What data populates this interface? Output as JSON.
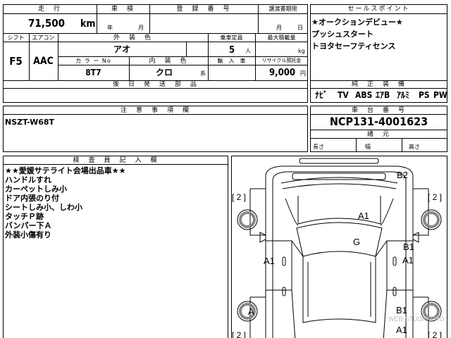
{
  "header": {
    "mileage_label": "走　行",
    "shaken_label": "車　検",
    "reg_label": "登　録　番　号",
    "transfer_deadline_label": "譲渡書期限",
    "sales_point_label": "セールスポイント",
    "mileage_value": "71,500",
    "mileage_unit": "km",
    "shaken_year_unit": "年",
    "shaken_month_unit": "月",
    "transfer_month_unit": "月",
    "transfer_day_unit": "日"
  },
  "sales_points": [
    "★オークションデビュー★",
    "プッシュスタート",
    "トヨタセーフティセンス"
  ],
  "spec": {
    "shift_label": "シフト",
    "aircon_label": "エアコン",
    "ext_color_label": "外　装　色",
    "capacity_label": "乗車定員",
    "max_load_label": "最大積載量",
    "shift_value": "F5",
    "aircon_value": "AAC",
    "ext_color_value": "アオ",
    "capacity_value": "5",
    "capacity_unit": "人",
    "max_load_unit": "kg",
    "color_no_label": "カ ラ ー No",
    "int_color_label": "内　装　色",
    "import_label": "輸　入　車",
    "recycle_label": "リサイクル預託金",
    "color_no_value": "8T7",
    "int_color_value": "クロ",
    "int_color_suffix": "系",
    "recycle_value": "9,000",
    "recycle_unit": "円",
    "retrofit_label": "後　日　発　送　部　品",
    "genuine_label": "純　正　装　備",
    "equipment": [
      "ﾅﾋﾞ",
      "TV",
      "ABS",
      "ｴｱB",
      "ｱﾙﾐ",
      "PS",
      "PW"
    ]
  },
  "caution": {
    "label": "注　意　事　項　欄",
    "value": "NSZT-W68T"
  },
  "chassis": {
    "label": "車　台　番　号",
    "value": "NCP131-4001623",
    "dims_label": "諸　元",
    "length_label": "長さ",
    "width_label": "幅",
    "height_label": "高さ"
  },
  "inspector": {
    "label": "検　査　員　記　入　欄",
    "notes": [
      "★★愛媛サテライト会場出品車★★",
      "ハンドルすれ",
      "カーペットしみ小",
      "ドア内張のり付",
      "シートしみ小、しわ小",
      "タッチＰ跡",
      "バンパー下Ａ",
      "外装小傷有り"
    ]
  },
  "diagram": {
    "marks": {
      "b2": "B2",
      "a1_hood": "A1",
      "g_windshield": "G",
      "a1_left": "A1",
      "b1_right_a": "B1",
      "a1_right": "A1",
      "a_circle": "A",
      "b1_right_b": "B1",
      "a1_bottom": "A1",
      "br_tl": "[ 2 ]",
      "br_tr": "[ 2 ]",
      "br_bl": "[ 2 ]",
      "br_br": "[ 2 ]"
    },
    "watermark": "WEB-STUDIO.PRO"
  }
}
